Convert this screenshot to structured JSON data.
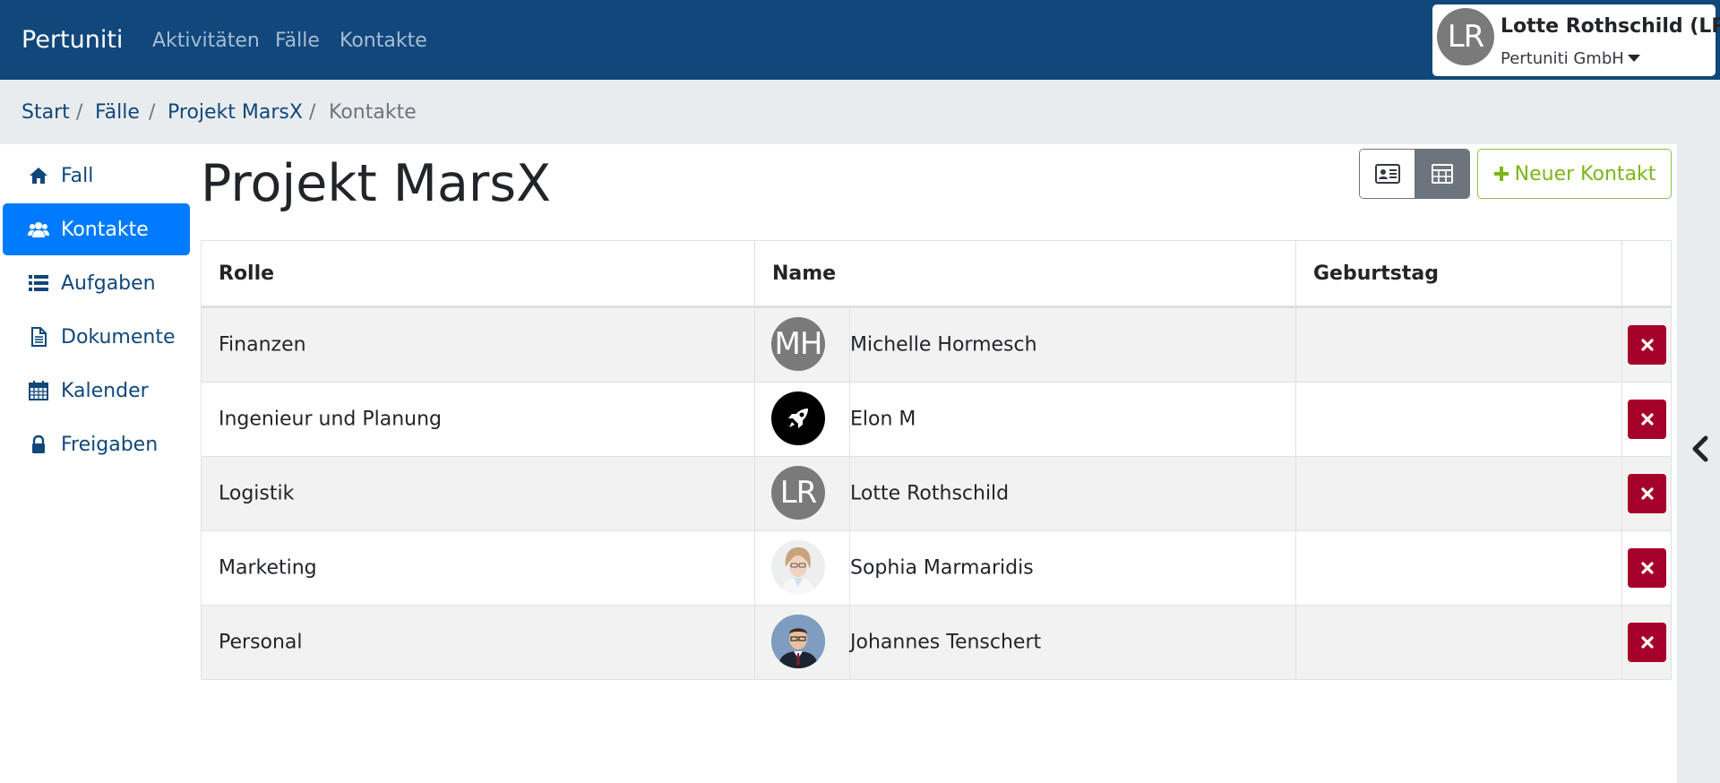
{
  "navbar": {
    "brand": "Pertuniti",
    "links": [
      "Aktivitäten",
      "Fälle",
      "Kontakte"
    ],
    "user": {
      "initials": "LR",
      "name": "Lotte Rothschild (LR)",
      "company": "Pertuniti GmbH"
    }
  },
  "breadcrumb": [
    "Start",
    "Fälle",
    "Projekt MarsX",
    "Kontakte"
  ],
  "breadcrumb_separator": "/",
  "sidebar": {
    "items": [
      {
        "label": "Fall",
        "icon": "home-icon"
      },
      {
        "label": "Kontakte",
        "icon": "users-icon",
        "active": true
      },
      {
        "label": "Aufgaben",
        "icon": "list-icon"
      },
      {
        "label": "Dokumente",
        "icon": "document-icon"
      },
      {
        "label": "Kalender",
        "icon": "calendar-icon"
      },
      {
        "label": "Freigaben",
        "icon": "lock-icon"
      }
    ]
  },
  "page": {
    "title": "Projekt MarsX",
    "new_contact_label": "Neuer Kontakt"
  },
  "table": {
    "headers": [
      "Rolle",
      "Name",
      "Geburtstag",
      ""
    ],
    "rows": [
      {
        "role": "Finanzen",
        "name": "Michelle Hormesch",
        "avatar": "MH",
        "birthday": ""
      },
      {
        "role": "Ingenieur und Planung",
        "name": "Elon M",
        "avatar": "rocket-icon",
        "birthday": ""
      },
      {
        "role": "Logistik",
        "name": "Lotte Rothschild",
        "avatar": "LR",
        "birthday": ""
      },
      {
        "role": "Marketing",
        "name": "Sophia Marmaridis",
        "avatar": "photo-woman",
        "birthday": ""
      },
      {
        "role": "Personal",
        "name": "Johannes Tenschert",
        "avatar": "photo-man",
        "birthday": ""
      }
    ]
  },
  "colors": {
    "navbar": "#11477b",
    "active": "#007bff",
    "success": "#7cb518",
    "danger": "#a5002a"
  }
}
